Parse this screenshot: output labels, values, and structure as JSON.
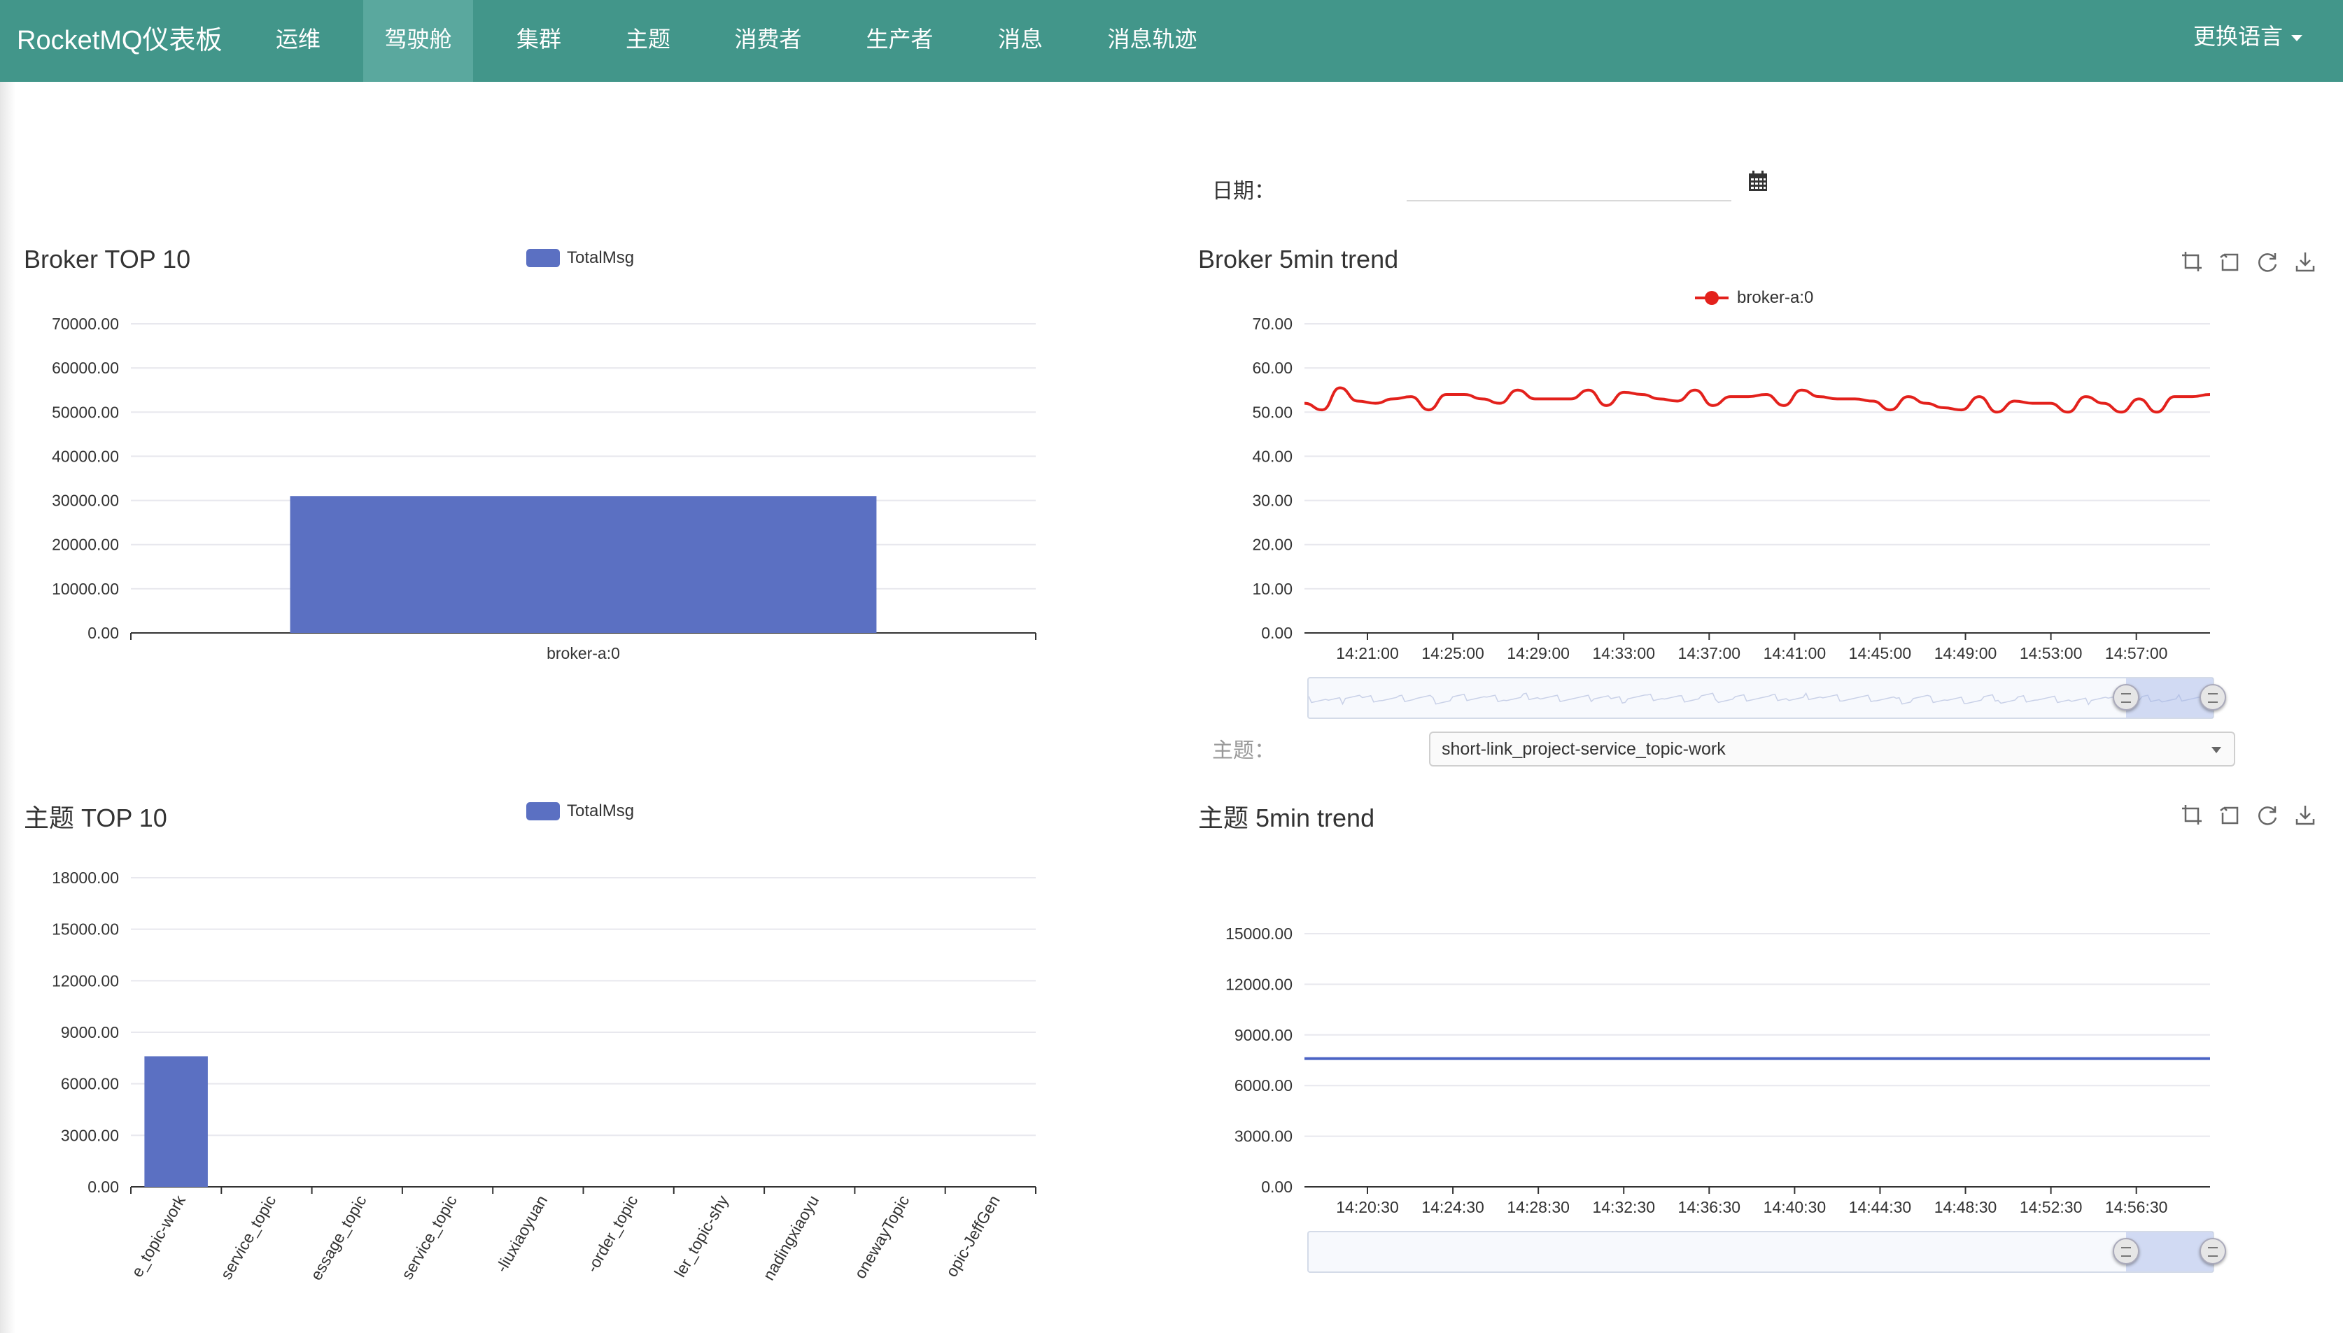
{
  "nav": {
    "brand": "RocketMQ仪表板",
    "items": [
      {
        "label": "运维",
        "active": false
      },
      {
        "label": "驾驶舱",
        "active": true
      },
      {
        "label": "集群",
        "active": false
      },
      {
        "label": "主题",
        "active": false
      },
      {
        "label": "消费者",
        "active": false
      },
      {
        "label": "生产者",
        "active": false
      },
      {
        "label": "消息",
        "active": false
      },
      {
        "label": "消息轨迹",
        "active": false
      }
    ],
    "language": "更换语言"
  },
  "date_filter": {
    "label": "日期：",
    "value": ""
  },
  "topic_filter": {
    "label": "主题：",
    "selected": "short-link_project-service_topic-work"
  },
  "panels": {
    "broker_top10": {
      "title": "Broker TOP 10",
      "legend": "TotalMsg"
    },
    "broker_trend": {
      "title": "Broker 5min trend",
      "legend": "broker-a:0"
    },
    "topic_top10": {
      "title": "主题 TOP 10",
      "legend": "TotalMsg"
    },
    "topic_trend": {
      "title": "主题 5min trend"
    }
  },
  "colors": {
    "navbar": "#42968a",
    "nav_active": "#5aa89e",
    "bar": "#5b70c2",
    "trend_line": "#e3211c",
    "topic_line": "#4b63c4"
  },
  "icons": [
    "calendar-icon",
    "zoom-area-icon",
    "zoom-reset-icon",
    "restore-icon",
    "save-image-icon"
  ],
  "chart_data": [
    {
      "id": "broker_top10",
      "type": "bar",
      "categories": [
        "broker-a:0"
      ],
      "series": [
        {
          "name": "TotalMsg",
          "values": [
            31000
          ]
        }
      ],
      "y_ticks": [
        "0.00",
        "10000.00",
        "20000.00",
        "30000.00",
        "40000.00",
        "50000.00",
        "60000.00",
        "70000.00"
      ],
      "ylim": [
        0,
        70000
      ],
      "grid": true
    },
    {
      "id": "broker_trend",
      "type": "line",
      "series": [
        {
          "name": "broker-a:0",
          "values": [
            52,
            50.5,
            55.5,
            52.5,
            52,
            53,
            53.5,
            50.5,
            54,
            54,
            53,
            52,
            55,
            53,
            53,
            53,
            55,
            51.5,
            54.5,
            54,
            53,
            52.5,
            55,
            51.5,
            53.5,
            53.5,
            54,
            51.5,
            55,
            53.5,
            53,
            53,
            52.5,
            50.5,
            53.5,
            52,
            51,
            50.5,
            53.5,
            50,
            52.5,
            52,
            52,
            50,
            53.5,
            52,
            50,
            53,
            50,
            53.5,
            53.5,
            54
          ]
        }
      ],
      "x_ticks": [
        "14:21:00",
        "14:25:00",
        "14:29:00",
        "14:33:00",
        "14:37:00",
        "14:41:00",
        "14:45:00",
        "14:49:00",
        "14:53:00",
        "14:57:00"
      ],
      "y_ticks": [
        "0.00",
        "10.00",
        "20.00",
        "30.00",
        "40.00",
        "50.00",
        "60.00",
        "70.00"
      ],
      "ylim": [
        0,
        70
      ],
      "grid": true,
      "legend_position": "top-center"
    },
    {
      "id": "topic_top10",
      "type": "bar",
      "categories": [
        "e_topic-work",
        "service_topic",
        "essage_topic",
        "service_topic",
        "-liuxiaoyuan",
        "-order_topic",
        "ler_topic-shy",
        "nadingxiaoyu",
        "onewayTopic",
        "opic-JeffGen"
      ],
      "series": [
        {
          "name": "TotalMsg",
          "values": [
            7600,
            0,
            0,
            0,
            0,
            0,
            0,
            0,
            0,
            0
          ]
        }
      ],
      "y_ticks": [
        "0.00",
        "3000.00",
        "6000.00",
        "9000.00",
        "12000.00",
        "15000.00",
        "18000.00"
      ],
      "ylim": [
        0,
        18000
      ],
      "grid": true
    },
    {
      "id": "topic_trend",
      "type": "line",
      "series": [
        {
          "values": [
            7600,
            7600
          ]
        }
      ],
      "x_ticks": [
        "14:20:30",
        "14:24:30",
        "14:28:30",
        "14:32:30",
        "14:36:30",
        "14:40:30",
        "14:44:30",
        "14:48:30",
        "14:52:30",
        "14:56:30"
      ],
      "y_ticks": [
        "0.00",
        "3000.00",
        "6000.00",
        "9000.00",
        "12000.00",
        "15000.00"
      ],
      "ylim": [
        0,
        15000
      ],
      "grid": true
    }
  ]
}
